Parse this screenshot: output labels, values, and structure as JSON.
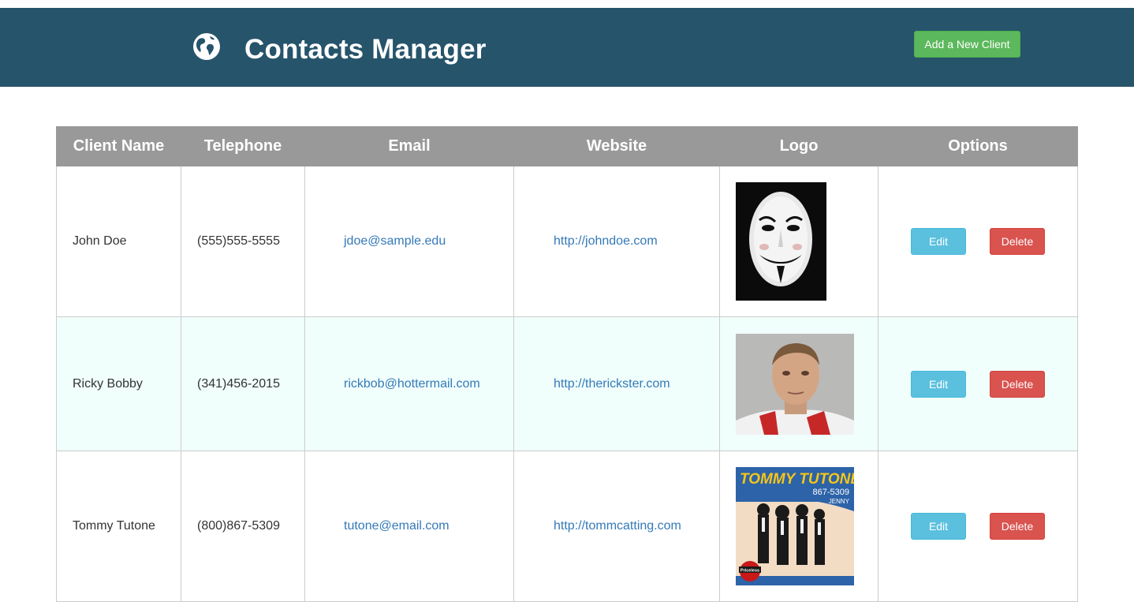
{
  "app": {
    "title": "Contacts Manager",
    "add_button_label": "Add a New Client"
  },
  "table": {
    "headers": {
      "name": "Client Name",
      "phone": "Telephone",
      "email": "Email",
      "website": "Website",
      "logo": "Logo",
      "options": "Options"
    },
    "rows": [
      {
        "name": "John Doe",
        "phone": "(555)555-5555",
        "email": "jdoe@sample.edu",
        "website": "http://johndoe.com",
        "logo_icon": "guy-fawkes-mask-image",
        "edit_label": "Edit",
        "delete_label": "Delete"
      },
      {
        "name": "Ricky Bobby",
        "phone": "(341)456-2015",
        "email": "rickbob@hottermail.com",
        "website": "http://therickster.com",
        "logo_icon": "racer-portrait-image",
        "edit_label": "Edit",
        "delete_label": "Delete"
      },
      {
        "name": "Tommy Tutone",
        "phone": "(800)867-5309",
        "email": "tutone@email.com",
        "website": "http://tommcatting.com",
        "logo_icon": "album-cover-image",
        "edit_label": "Edit",
        "delete_label": "Delete",
        "album_title": "TOMMY TUTONE",
        "album_number": "867-5309",
        "album_subtitle": "JENNY",
        "album_badge": "Priceless"
      }
    ]
  },
  "colors": {
    "header_bg": "#26546b",
    "success": "#5cb85c",
    "info": "#5bc0de",
    "danger": "#d9534f",
    "link": "#3479b8",
    "table_header_bg": "#999999",
    "highlight_row_bg": "#f0fffc"
  }
}
